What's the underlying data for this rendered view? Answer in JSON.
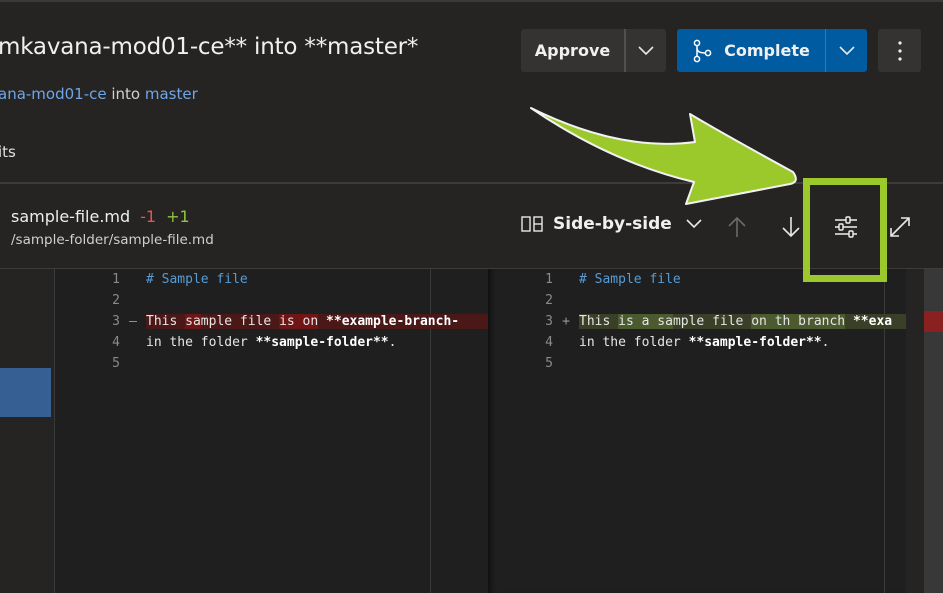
{
  "header": {
    "title": "mkavana-mod01-ce** into **master*",
    "subtitle_branch": "ana-mod01-ce",
    "subtitle_into": " into ",
    "subtitle_target": "master",
    "tab_partial": "its"
  },
  "actions": {
    "approve_label": "Approve",
    "complete_label": "Complete",
    "approve_menu_icon": "chevron-down-icon",
    "complete_menu_icon": "chevron-down-icon",
    "complete_icon": "branch-merge-icon",
    "more_icon": "more-vertical-icon"
  },
  "file": {
    "name": "sample-file.md",
    "deletions": "-1",
    "additions": "+1",
    "path": "/sample-folder/sample-file.md"
  },
  "toolbar": {
    "view_mode": "Side-by-side",
    "view_mode_icon": "side-by-side-icon",
    "prev_icon": "arrow-up-icon",
    "next_icon": "arrow-down-icon",
    "settings_icon": "settings-sliders-icon",
    "expand_icon": "expand-icon"
  },
  "diff": {
    "left": {
      "lines": [
        {
          "num": "1",
          "marker": "",
          "text": "# Sample file"
        },
        {
          "num": "2",
          "marker": "",
          "text": ""
        },
        {
          "num": "3",
          "marker": "—",
          "pre": "This ",
          "w1": "sa",
          "mid": "mple file ",
          "w2": "is on",
          "post": " ",
          "bold": "**example-branch-"
        },
        {
          "num": "4",
          "marker": "",
          "pre": "in the folder ",
          "bold": "**sample-folder**",
          "post": "."
        },
        {
          "num": "5",
          "marker": "",
          "text": ""
        }
      ]
    },
    "right": {
      "lines": [
        {
          "num": "1",
          "marker": "",
          "text": "# Sample file"
        },
        {
          "num": "2",
          "marker": "",
          "text": ""
        },
        {
          "num": "3",
          "marker": "+",
          "pre": "This ",
          "w1": "is a sa",
          "mid": "mple file ",
          "w2": "on th branch",
          "post": " ",
          "bold": "**exa"
        },
        {
          "num": "4",
          "marker": "",
          "pre": "in the folder ",
          "bold": "**sample-folder**",
          "post": "."
        },
        {
          "num": "5",
          "marker": "",
          "text": ""
        }
      ]
    }
  },
  "annotation": {
    "color": "#9bc92c",
    "target": "settings-sliders-icon"
  }
}
